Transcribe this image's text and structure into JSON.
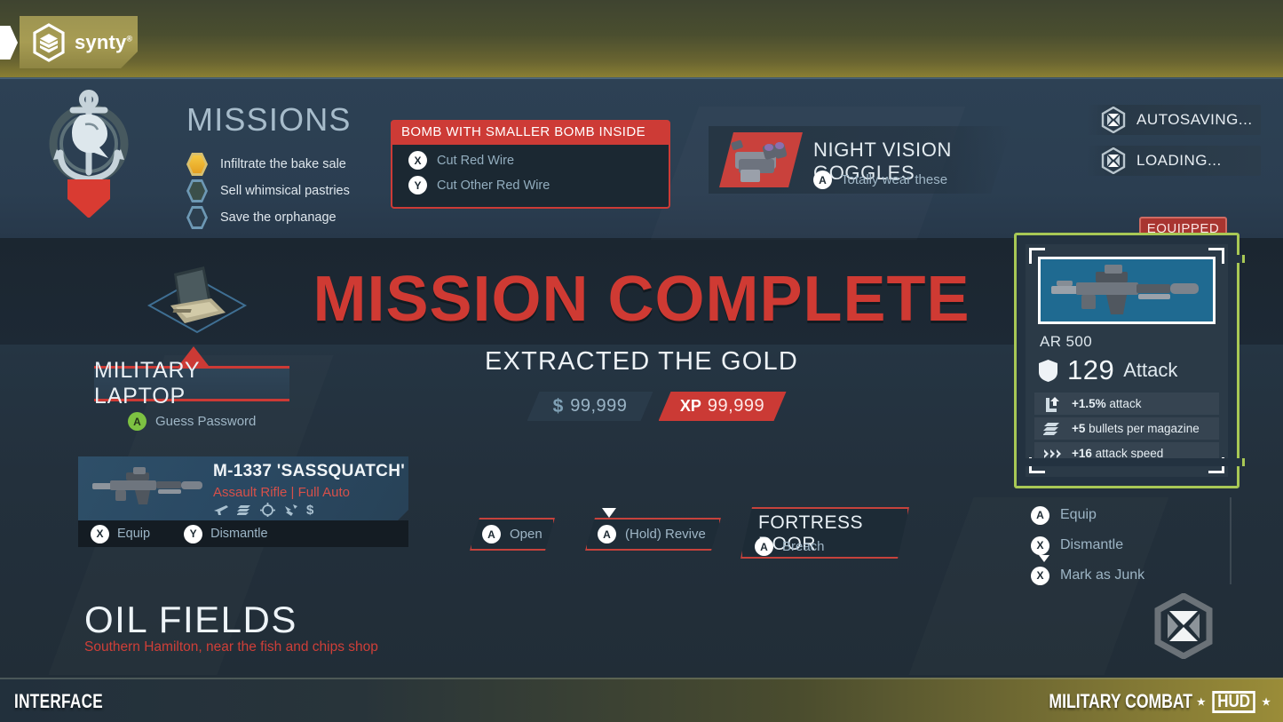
{
  "brand": {
    "logo_text": "synty",
    "logo_sup": "®",
    "logo_icon": "hexagon-layers-icon"
  },
  "missions": {
    "title": "MISSIONS",
    "emblem_icon": "anchor-shark-emblem",
    "items": [
      {
        "label": "Infiltrate the bake sale",
        "state": "complete"
      },
      {
        "label": "Sell whimsical pastries",
        "state": "active"
      },
      {
        "label": "Save the orphanage",
        "state": "incomplete"
      }
    ]
  },
  "bomb_panel": {
    "header": "BOMB WITH SMALLER BOMB INSIDE",
    "options": [
      {
        "button": "X",
        "label": "Cut Red Wire"
      },
      {
        "button": "Y",
        "label": "Cut Other Red Wire"
      }
    ]
  },
  "nvg_panel": {
    "title": "NIGHT VISION GOGGLES",
    "icon": "goggles-icon",
    "prompt_button": "A",
    "prompt_label": "Totally wear these"
  },
  "status": {
    "items": [
      {
        "icon": "hex-x-icon",
        "label": "AUTOSAVING..."
      },
      {
        "icon": "hex-x-icon",
        "label": "LOADING..."
      }
    ]
  },
  "laptop": {
    "icon": "laptop-icon",
    "name": "MILITARY LAPTOP",
    "prompt_button": "A",
    "prompt_label": "Guess Password"
  },
  "mission_complete": {
    "title": "MISSION COMPLETE",
    "subtitle": "EXTRACTED THE GOLD",
    "cash_symbol": "$",
    "cash_value": "99,999",
    "xp_symbol": "XP",
    "xp_value": "99,999"
  },
  "item_card": {
    "thumb_icon": "assault-rifle-icon",
    "name": "M-1337 'SASSQUATCH'",
    "type": "Assault Rifle | Full Auto",
    "stat_icons": [
      "rifle-icon",
      "magazine-icon",
      "crosshair-icon",
      "bird-speed-icon",
      "dollar-icon"
    ],
    "actions": [
      {
        "button": "X",
        "label": "Equip"
      },
      {
        "button": "Y",
        "label": "Dismantle"
      }
    ]
  },
  "action_prompts": {
    "open": {
      "button": "A",
      "label": "Open"
    },
    "revive": {
      "button": "A",
      "label": "(Hold) Revive"
    },
    "door": {
      "title": "FORTRESS DOOR",
      "button": "A",
      "label": "Breach"
    }
  },
  "location": {
    "name": "OIL FIELDS",
    "description": "Southern Hamilton, near the fish and chips shop"
  },
  "weapon_panel": {
    "equipped_tag": "EQUIPPED",
    "image_icon": "assault-rifle-icon",
    "name": "AR 500",
    "attack_icon": "shield-icon",
    "attack_value": "129",
    "attack_label": "Attack",
    "stats": [
      {
        "icon": "attack-up-icon",
        "value": "+1.5%",
        "label": "attack"
      },
      {
        "icon": "magazine-icon",
        "value": "+5",
        "label": "bullets per magazine"
      },
      {
        "icon": "chevrons-icon",
        "value": "+16",
        "label": "attack speed"
      }
    ],
    "actions": [
      {
        "button": "A",
        "label": "Equip"
      },
      {
        "button": "X",
        "label": "Dismantle"
      },
      {
        "button": "X",
        "label": "Mark as Junk"
      }
    ]
  },
  "watermark_icon": "hex-x-icon",
  "footer": {
    "left": "INTERFACE",
    "right_prefix": "MILITARY COMBAT",
    "right_badge": "HUD"
  },
  "colors": {
    "accent_red": "#cd3b36",
    "accent_green": "#a8c855",
    "background": "#212e38",
    "text_light": "#e8eef3",
    "text_muted": "#9fb6c6",
    "brand_gold": "#9e9552"
  }
}
